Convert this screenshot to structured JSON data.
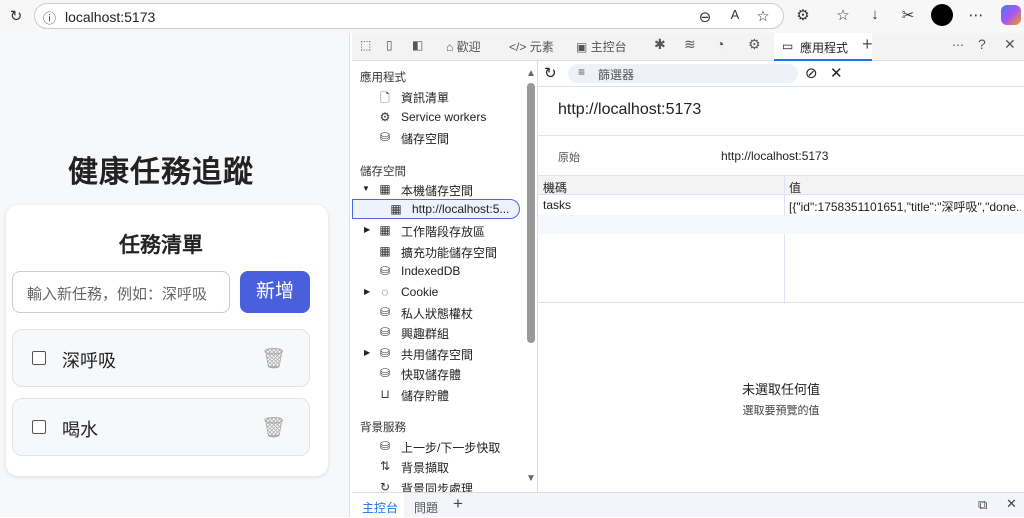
{
  "browser": {
    "url": "localhost:5173"
  },
  "app": {
    "title": "健康任務追蹤",
    "card_title": "任務清單",
    "input_placeholder": "輸入新任務，例如：深呼吸",
    "add_button": "新增",
    "tasks": [
      {
        "title": "深呼吸",
        "done": false
      },
      {
        "title": "喝水",
        "done": false
      }
    ]
  },
  "devtools": {
    "tabs": [
      "歡迎",
      "元素",
      "主控台",
      "應用程式"
    ],
    "active_tab": "應用程式",
    "sidebar": {
      "sections": [
        {
          "title": "應用程式",
          "items": [
            "資訊清單",
            "Service workers",
            "儲存空間"
          ]
        },
        {
          "title": "儲存空間",
          "items": [
            "本機儲存空間",
            "http://localhost:5...",
            "工作階段存放區",
            "擴充功能儲存空間",
            "IndexedDB",
            "Cookie",
            "私人狀態權杖",
            "興趣群組",
            "共用儲存空間",
            "快取儲存體",
            "儲存貯體"
          ]
        },
        {
          "title": "背景服務",
          "items": [
            "上一步/下一步快取",
            "背景擷取",
            "背景同步處理"
          ]
        }
      ]
    },
    "filter_placeholder": "篩選器",
    "origin_header": "http://localhost:5173",
    "origin_label": "原始",
    "origin_value": "http://localhost:5173",
    "table": {
      "headers": [
        "機碼",
        "值"
      ],
      "rows": [
        {
          "key": "tasks",
          "value": "[{\"id\":1758351101651,\"title\":\"深呼吸\",\"done..."
        }
      ]
    },
    "empty_title": "未選取任何值",
    "empty_sub": "選取要預覽的值",
    "drawer_tabs": [
      "主控台",
      "問題"
    ]
  },
  "colors": {
    "accent": "#4a5fdb",
    "devtools_active": "#1a73e8"
  }
}
